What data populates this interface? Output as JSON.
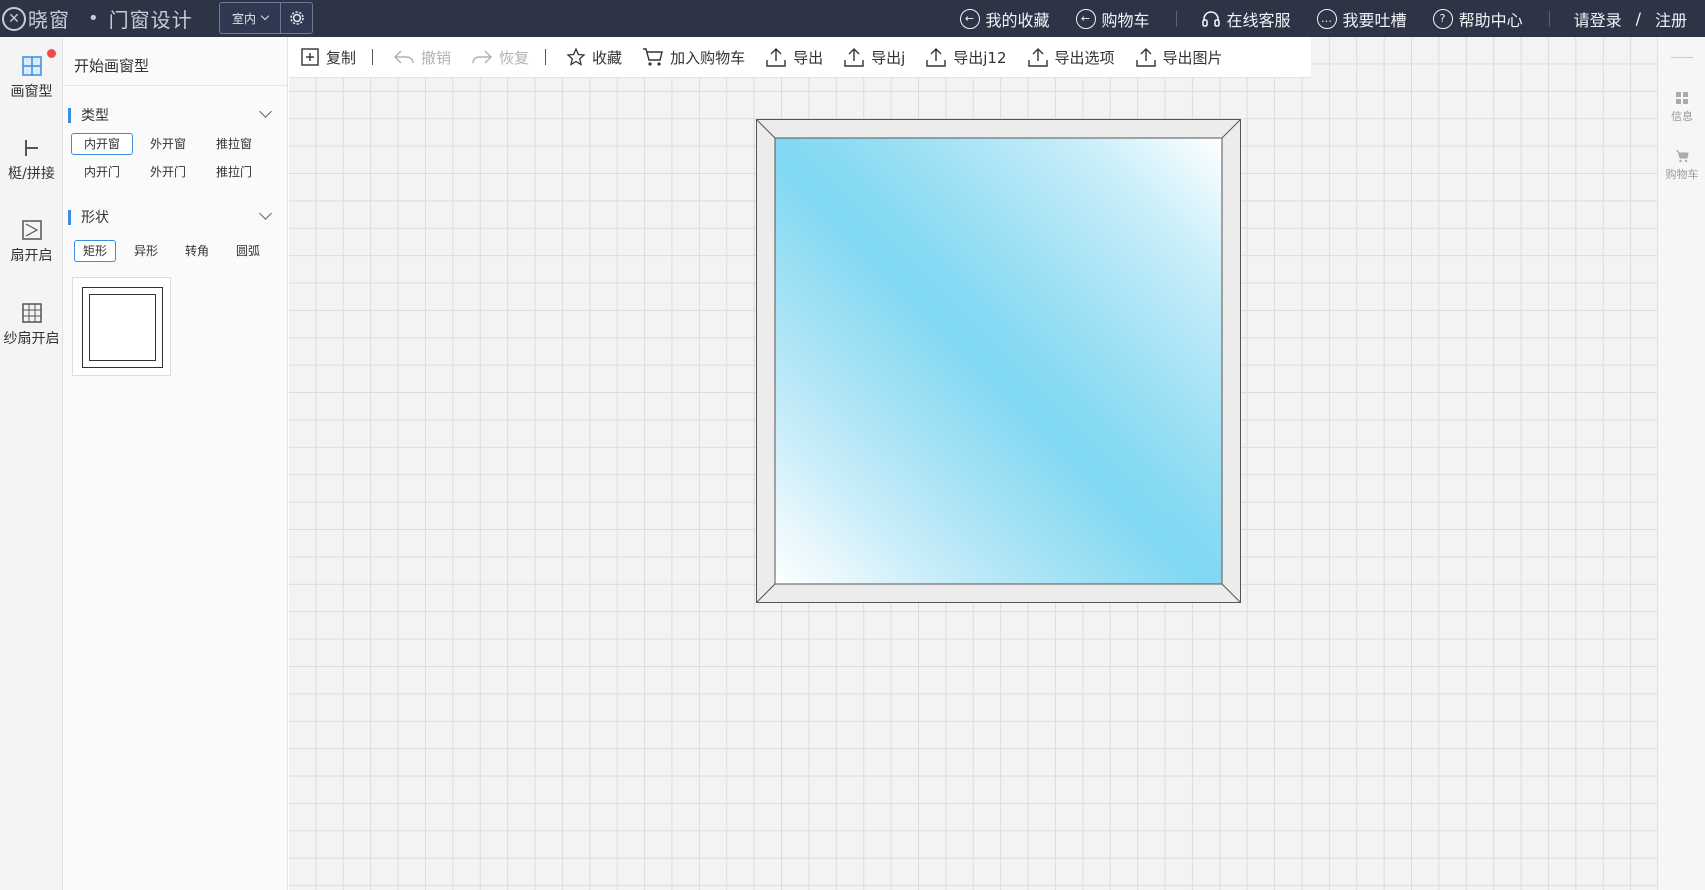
{
  "topbar": {
    "logo_mark": "✕",
    "logo_text": "晓窗",
    "dot": "•",
    "app_title": "门窗设计",
    "mode_select": "室内",
    "nav": [
      {
        "label": "我的收藏",
        "icon": "arrow-left-circle-icon",
        "glyph": "←"
      },
      {
        "label": "购物车",
        "icon": "arrow-left-circle-icon",
        "glyph": "←"
      },
      {
        "label": "在线客服",
        "icon": "headset-icon"
      },
      {
        "label": "我要吐槽",
        "icon": "chat-bubble-icon",
        "glyph": "…"
      },
      {
        "label": "帮助中心",
        "icon": "question-circle-icon",
        "glyph": "?"
      }
    ],
    "login": "请登录",
    "slash": "/",
    "register": "注册"
  },
  "left_rail": {
    "items": [
      {
        "label": "画窗型",
        "icon": "grid-window-icon"
      },
      {
        "label": "梃/拼接",
        "icon": "mullion-icon"
      },
      {
        "label": "扇开启",
        "icon": "sash-open-icon"
      },
      {
        "label": "纱扇开启",
        "icon": "screen-sash-icon"
      }
    ]
  },
  "left_panel": {
    "title": "开始画窗型",
    "type_section": {
      "label": "类型",
      "options": [
        "内开窗",
        "外开窗",
        "推拉窗",
        "内开门",
        "外开门",
        "推拉门"
      ],
      "selected": "内开窗"
    },
    "shape_section": {
      "label": "形状",
      "options": [
        "矩形",
        "异形",
        "转角",
        "圆弧"
      ],
      "selected": "矩形"
    }
  },
  "toolbar": {
    "items": [
      {
        "label": "复制",
        "icon": "copy-add-icon",
        "enabled": true
      },
      {
        "label": "撤销",
        "icon": "undo-icon",
        "enabled": false
      },
      {
        "label": "恢复",
        "icon": "redo-icon",
        "enabled": false
      },
      {
        "label": "收藏",
        "icon": "star-icon",
        "enabled": true
      },
      {
        "label": "加入购物车",
        "icon": "cart-icon",
        "enabled": true
      },
      {
        "label": "导出",
        "icon": "export-icon",
        "enabled": true
      },
      {
        "label": "导出j",
        "icon": "export-icon",
        "enabled": true
      },
      {
        "label": "导出j12",
        "icon": "export-icon",
        "enabled": true
      },
      {
        "label": "导出选项",
        "icon": "export-icon",
        "enabled": true
      },
      {
        "label": "导出图片",
        "icon": "export-icon",
        "enabled": true
      }
    ]
  },
  "right_rail": {
    "items": [
      {
        "label": "信息",
        "icon": "grid-info-icon"
      },
      {
        "label": "购物车",
        "icon": "cart-icon"
      }
    ]
  },
  "colors": {
    "topbar_bg": "#2d3446",
    "accent": "#3c8de0",
    "red_dot": "#f44b4b",
    "glass_blue": "#80d8f2"
  }
}
